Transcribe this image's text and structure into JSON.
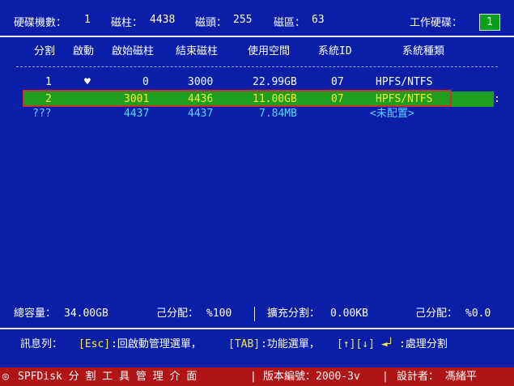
{
  "header": {
    "disk_count_label": "硬碟機數：",
    "disk_count": "1",
    "cylinders_label": "磁柱：",
    "cylinders": "4438",
    "heads_label": "磁頭：",
    "heads": "255",
    "sectors_label": "磁區：",
    "sectors": "63",
    "work_disk_label": "工作硬碟：",
    "work_disk": "1"
  },
  "columns": [
    "分割",
    "啟動",
    "啟始磁柱",
    "結束磁柱",
    "使用空間",
    "系統ID",
    "系統種類"
  ],
  "rows": [
    {
      "part": "1",
      "boot": "♥",
      "start": "0",
      "end": "3000",
      "size": "22.99GB",
      "sysid": "07",
      "type": "HPFS/NTFS"
    },
    {
      "part": "2",
      "boot": "",
      "start": "3001",
      "end": "4436",
      "size": "11.00GB",
      "sysid": "07",
      "type": "HPFS/NTFS"
    },
    {
      "part": "???",
      "boot": "",
      "start": "4437",
      "end": "4437",
      "size": "7.84MB",
      "sysid": "",
      "type": "<未配置>"
    }
  ],
  "summary": {
    "total_label": "總容量：",
    "total": "34.00GB",
    "alloc_label": "己分配：",
    "alloc": "%100",
    "ext_label": "擴充分割：",
    "ext": "0.00KB",
    "alloc2_label": "己分配：",
    "alloc2": "%0.0"
  },
  "message": {
    "label": "訊息列：",
    "esc_key": "[Esc]",
    "esc_text": ":回啟動管理選單，",
    "tab_key": "[TAB]",
    "tab_text": ":功能選單，",
    "arrow_key": "[↑][↓] ◄┘",
    "arrow_text": ":處理分割"
  },
  "statusbar": {
    "icon": "◎",
    "app": "SPFDisk 分 割 工 具 管 理 介 面",
    "version": "版本編號：2000-3v",
    "author": "設計者： 馮緒平"
  },
  "colors": {
    "background": "#0a1ea8",
    "selected_row": "#1f9e1f",
    "selection_border": "#c7342f",
    "statusbar": "#b01515",
    "highlight_yellow": "#f6ee3a",
    "unallocated_cyan": "#5ad6ff"
  }
}
